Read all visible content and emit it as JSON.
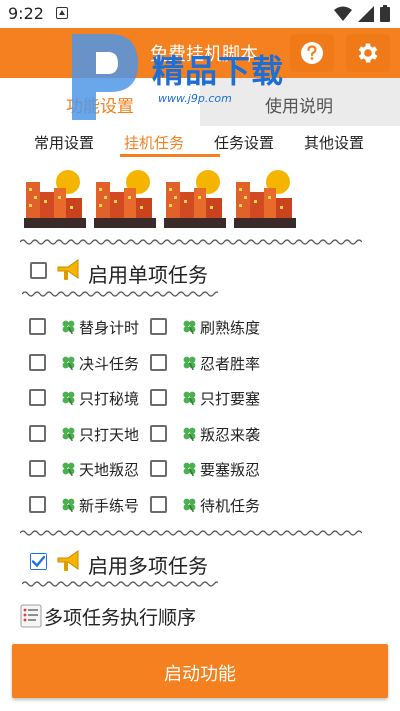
{
  "status_bar": {
    "time": "9:22"
  },
  "app_bar": {
    "title": "免费挂机脚本"
  },
  "watermark": {
    "brand": "精品下载",
    "url": "www.j9p.com"
  },
  "main_tabs": [
    {
      "label": "功能设置",
      "active": true
    },
    {
      "label": "使用说明",
      "active": false
    }
  ],
  "sub_tabs": [
    {
      "label": "常用设置",
      "active": false
    },
    {
      "label": "挂机任务",
      "active": true
    },
    {
      "label": "任务设置",
      "active": false
    },
    {
      "label": "其他设置",
      "active": false
    }
  ],
  "single_task": {
    "label": "启用单项任务",
    "checked": false
  },
  "task_items": [
    {
      "label": "替身计时",
      "checked": false
    },
    {
      "label": "刷熟练度",
      "checked": false
    },
    {
      "label": "决斗任务",
      "checked": false
    },
    {
      "label": "忍者胜率",
      "checked": false
    },
    {
      "label": "只打秘境",
      "checked": false
    },
    {
      "label": "只打要塞",
      "checked": false
    },
    {
      "label": "只打天地",
      "checked": false
    },
    {
      "label": "叛忍来袭",
      "checked": false
    },
    {
      "label": "天地叛忍",
      "checked": false
    },
    {
      "label": "要塞叛忍",
      "checked": false
    },
    {
      "label": "新手练号",
      "checked": false
    },
    {
      "label": "待机任务",
      "checked": false
    }
  ],
  "multi_task": {
    "label": "启用多项任务",
    "checked": true
  },
  "order_label": "多项任务执行顺序",
  "start_button": {
    "label": "启动功能"
  },
  "colors": {
    "accent": "#f48020",
    "check_blue": "#1a73e8"
  }
}
